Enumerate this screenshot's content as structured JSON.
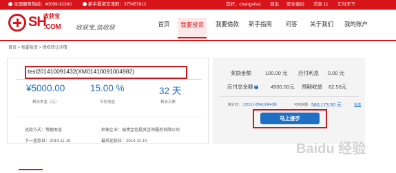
{
  "topbar": {
    "hotline_label": "全国服务热线：",
    "hotline_number": "40099-32360",
    "qq_label": "新手投资交流群：",
    "qq_number": "375457812",
    "greeting": "您好，",
    "username": "changsha1",
    "exit": "退出",
    "security": "安全退出",
    "messages": "消息 11",
    "recharge": "汇付天下"
  },
  "logo": {
    "sh": "SH",
    "cn": "收获宝",
    "com": ".COM",
    "slogan": "收获宝,信收获"
  },
  "nav": {
    "items": [
      "首页",
      "我要投资",
      "我要借款",
      "新手指南",
      "问答",
      "关于我们",
      "我的账户"
    ],
    "active": "我要投资"
  },
  "breadcrumb": "首页 > 我要投资 > 债权转让详情",
  "product": {
    "title": "test201410091432(XM01410091004982)",
    "principal": "¥5000.00",
    "principal_label": "剩余本金（元）",
    "rate": "15.00 %",
    "rate_label": "年化收益",
    "days": "32 天",
    "days_label": "剩余天数",
    "repay_method": "还款方式：等额本息",
    "guarantor": "担保企业：瑞博金信投资咨询服务有限公司",
    "next_repay": "下一还款日：2014-11-10",
    "last_repay": "最后还款日：2014-11-10"
  },
  "side": {
    "reward_label": "奖励金额",
    "reward_value": "100.00 元",
    "interest_label": "应付利息",
    "interest_value": "0.00 元",
    "total_label": "应付总金额",
    "total_value": "4900.00元",
    "expected_label": "预期收益",
    "expected_value": "62.50元",
    "countdown_label": "倒计时：",
    "countdown_value": "3天21小时46分钟43秒",
    "available_label": "可用余额：",
    "available_value": "580,173.50 元",
    "recharge_link": "充值",
    "button": "马上接手",
    "help": "?"
  },
  "watermark": "Baidu 经验"
}
